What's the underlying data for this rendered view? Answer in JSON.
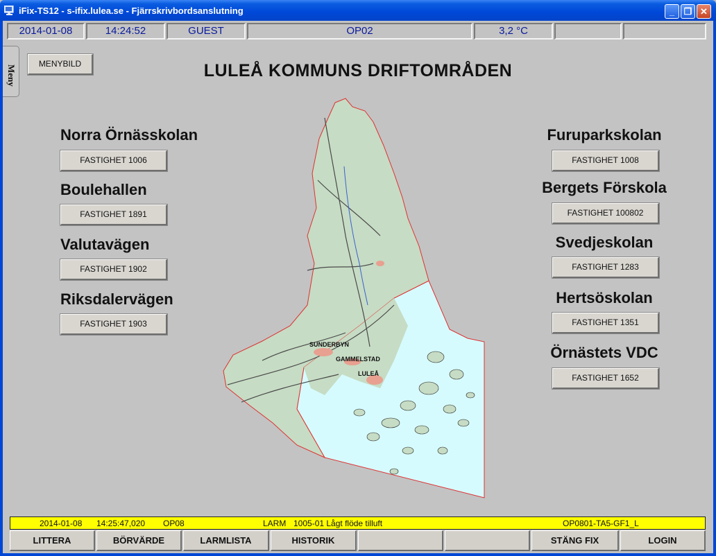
{
  "window": {
    "title": "iFix-TS12 - s-ifix.lulea.se - Fjärrskrivbordsanslutning",
    "minimize_label": "_",
    "restore_label": "❐",
    "close_label": "✕"
  },
  "status": {
    "date": "2014-01-08",
    "time": "14:24:52",
    "user": "GUEST",
    "node": "OP02",
    "temperature": "3,2 °C"
  },
  "side_tab": {
    "label": "Meny"
  },
  "menybild_label": "MENYBILD",
  "heading": "LULEÅ KOMMUNS DRIFTOMRÅDEN",
  "sites_left": [
    {
      "name": "Norra Örnässkolan",
      "button": "FASTIGHET 1006"
    },
    {
      "name": "Boulehallen",
      "button": "FASTIGHET 1891"
    },
    {
      "name": "Valutavägen",
      "button": "FASTIGHET 1902"
    },
    {
      "name": "Riksdalervägen",
      "button": "FASTIGHET 1903"
    }
  ],
  "sites_right": [
    {
      "name": "Furuparkskolan",
      "button": "FASTIGHET 1008"
    },
    {
      "name": "Bergets Förskola",
      "button": "FASTIGHET 100802"
    },
    {
      "name": "Svedjeskolan",
      "button": "FASTIGHET 1283"
    },
    {
      "name": "Hertsöskolan",
      "button": "FASTIGHET 1351"
    },
    {
      "name": "Örnästets VDC",
      "button": "FASTIGHET 1652"
    }
  ],
  "map_labels": {
    "a": "SUNDERBYN",
    "b": "GAMMELSTAD",
    "c": "LULEÅ"
  },
  "alarm": {
    "date": "2014-01-08",
    "time": "14:25:47,020",
    "node": "OP08",
    "type": "LARM",
    "message": "1005-01 Lågt flöde tilluft",
    "tag": "OP0801-TA5-GF1_L"
  },
  "bottom_buttons": {
    "b1": "LITTERA",
    "b2": "BÖRVÄRDE",
    "b3": "LARMLISTA",
    "b4": "HISTORIK",
    "b5": "",
    "b6": "",
    "b7": "STÄNG FIX",
    "b8": "LOGIN"
  },
  "colors": {
    "titlebar": "#0048d8",
    "background": "#c3c3c3",
    "status_text": "#0a1a9c",
    "alarm_bar": "#ffff00",
    "map_land": "#c6dcc4",
    "map_water": "#d6fbff",
    "map_border": "#e03030"
  }
}
